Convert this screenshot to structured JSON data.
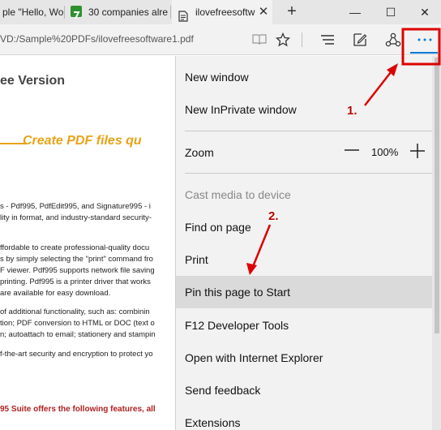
{
  "tabs": [
    {
      "label": "ple \"Hello, Wo"
    },
    {
      "label": "30 companies alre"
    },
    {
      "label": "ilovefreesoftw"
    }
  ],
  "window": {
    "new_tab": "+",
    "minimize": "—",
    "maximize": "☐",
    "close": "✕"
  },
  "address": {
    "url": "VD:/Sample%20PDFs/ilovefreesoftware1.pdf"
  },
  "pdf": {
    "title": "ee Version",
    "banner": "Create PDF files qu",
    "lines": [
      "s - Pdf995, PdfEdit995, and Signature995 - i",
      "lity in format, and industry-standard security-",
      "ffordable to create professional-quality docu",
      "s by simply selecting the \"print\" command fro",
      "F viewer. Pdf995 supports network file saving",
      " printing. Pdf995 is a printer driver that works",
      "are available for easy download.",
      "of additional functionality, such as: combinin",
      "tion; PDF conversion to HTML or DOC (text o",
      "n; autoattach to email; stationery and stampin",
      "f-the-art security and encryption to protect yo"
    ],
    "footer": "95 Suite offers the following features, all"
  },
  "menu": {
    "new_window": "New window",
    "new_inprivate": "New InPrivate window",
    "zoom_label": "Zoom",
    "zoom_value": "100%",
    "zoom_minus": "—",
    "zoom_plus": "+",
    "cast": "Cast media to device",
    "find": "Find on page",
    "print": "Print",
    "pin": "Pin this page to Start",
    "f12": "F12 Developer Tools",
    "open_ie": "Open with Internet Explorer",
    "feedback": "Send feedback",
    "extensions": "Extensions"
  },
  "annotations": {
    "step1": "1.",
    "step2": "2."
  },
  "colors": {
    "annotation": "#dd0000",
    "accent": "#0078d7",
    "menu_bg": "#f2f2f2",
    "highlight": "#dadada",
    "banner": "#e8a317"
  }
}
